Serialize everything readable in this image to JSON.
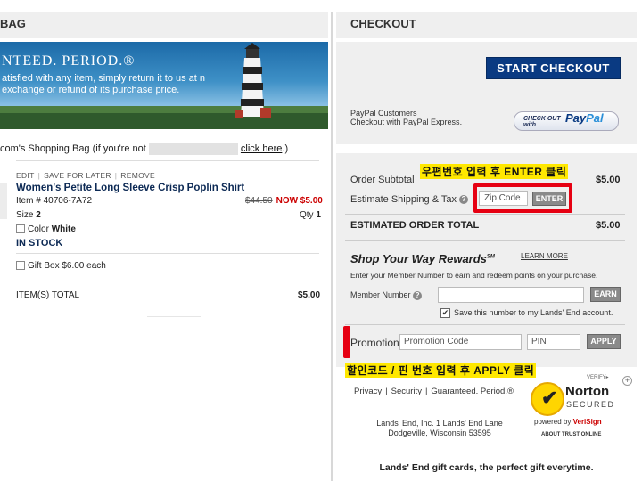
{
  "left": {
    "header": "BAG",
    "banner": {
      "title": "NTEED. PERIOD.®",
      "text": "atisfied with any item, simply return it to us at n exchange or refund of its purchase price."
    },
    "sign_prefix": "com's Shopping Bag (if you're not",
    "sign_link": "click here",
    "sign_suffix": ".)",
    "links": {
      "edit": "EDIT",
      "save_later": "SAVE FOR LATER",
      "remove": "REMOVE"
    },
    "item": {
      "name": "Women's Petite Long Sleeve Crisp Poplin Shirt",
      "number_label": "Item #",
      "number": "40706-7A72",
      "old_price": "$44.50",
      "now_price": "NOW $5.00",
      "size_label": "Size",
      "size": "2",
      "qty_label": "Qty",
      "qty": "1",
      "color_label": "Color",
      "color": "White",
      "stock": "IN STOCK",
      "giftbox": "Gift Box $6.00 each"
    },
    "total_label": "ITEM(S) TOTAL",
    "total_value": "$5.00"
  },
  "right": {
    "header": "CHECKOUT",
    "start_checkout": "START CHECKOUT",
    "paypal_line1": "PayPal Customers",
    "paypal_line2_prefix": "Checkout with ",
    "paypal_link": "PayPal Express",
    "paypal_line2_suffix": ".",
    "paypal_btn_small": "CHECK OUT with",
    "paypal_btn_pay": "Pay",
    "paypal_btn_pal": "Pal",
    "subtotal_label": "Order Subtotal",
    "subtotal_value": "$5.00",
    "shipping_label": "Estimate Shipping & Tax",
    "zip_placeholder": "Zip Code",
    "enter_btn": "ENTER",
    "est_total_label": "ESTIMATED ORDER TOTAL",
    "est_total_value": "$5.00",
    "syw_title": "Shop Your Way Rewards",
    "syw_sup": "SM",
    "learn_more": "LEARN MORE",
    "member_text": "Enter your Member Number to earn and redeem points on your purchase.",
    "member_label": "Member Number",
    "earn_btn": "EARN",
    "save_text": "Save this number to my Lands' End account.",
    "promo_label": "Promotion",
    "promo_placeholder": "Promotion Code",
    "pin_placeholder": "PIN",
    "apply_btn": "APPLY",
    "foot_privacy": "Privacy",
    "foot_security": "Security",
    "foot_guarantee": "Guaranteed. Period.®",
    "addr1": "Lands' End, Inc. 1 Lands' End Lane",
    "addr2": "Dodgeville, Wisconsin 53595",
    "gift_cards": "Lands' End gift cards, the perfect gift everytime.",
    "annot_zip": "우편번호 입력 후 ENTER 클릭",
    "annot_promo": "할인코드 / 핀 번호 입력 후 APPLY 클릭",
    "norton": {
      "verify": "VERIFY▸",
      "name": "Norton",
      "secured": "SECURED",
      "powered": "powered by",
      "verisign": "VeriSign",
      "about": "ABOUT TRUST ONLINE"
    }
  },
  "colors": {
    "accent": "#0a3a82",
    "annotation": "#e60012",
    "highlight": "#ffe800",
    "sale": "#cc0000"
  }
}
